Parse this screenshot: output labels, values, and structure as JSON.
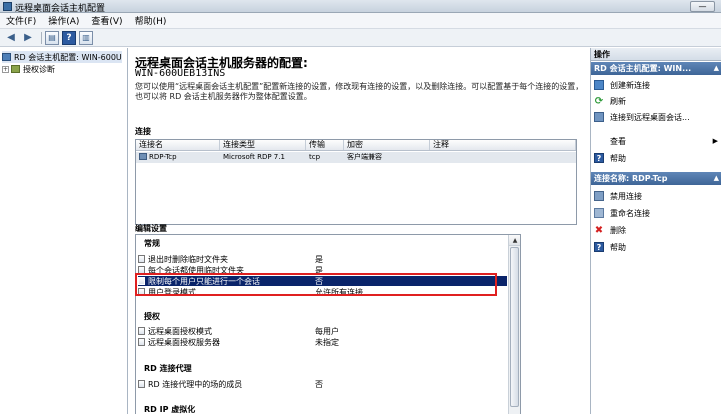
{
  "window": {
    "title": "远程桌面会话主机配置",
    "minimize_symbol": "—"
  },
  "menu": [
    "文件(F)",
    "操作(A)",
    "查看(V)",
    "帮助(H)"
  ],
  "tree": {
    "root_label": "RD 会话主机配置: WIN-600U",
    "child_label": "授权诊断"
  },
  "main": {
    "title": "远程桌面会话主机服务器的配置:",
    "server": "WIN-600UEB13INS",
    "description": "您可以使用“远程桌面会话主机配置”配置新连接的设置，修改现有连接的设置，以及删除连接。可以配置基于每个连接的设置，也可以将 RD 会话主机服务器作为整体配置设置。",
    "connections_label": "连接",
    "connections_columns": [
      "连接名",
      "连接类型",
      "传输",
      "加密",
      "注释"
    ],
    "connections_rows": [
      {
        "name": "RDP-Tcp",
        "type": "Microsoft RDP 7.1",
        "transport": "tcp",
        "encryption": "客户端兼容",
        "comment": ""
      }
    ],
    "edit_settings_label": "编辑设置",
    "groups": [
      {
        "title": "常规",
        "rows": [
          {
            "name": "退出时删除临时文件夹",
            "value": "是"
          },
          {
            "name": "每个会话都使用临时文件夹",
            "value": "是"
          },
          {
            "name": "限制每个用户只能进行一个会话",
            "value": "否"
          },
          {
            "name": "用户登录模式",
            "value": "允许所有连接"
          }
        ]
      },
      {
        "title": "授权",
        "rows": [
          {
            "name": "远程桌面授权模式",
            "value": "每用户"
          },
          {
            "name": "远程桌面授权服务器",
            "value": "未指定"
          }
        ]
      },
      {
        "title": "RD 连接代理",
        "rows": [
          {
            "name": "RD 连接代理中的场的成员",
            "value": "否"
          }
        ]
      },
      {
        "title": "RD IP 虚拟化",
        "rows": []
      }
    ]
  },
  "actions": {
    "header": "操作",
    "section1_title": "RD 会话主机配置: WIN...",
    "section1_items": [
      "创建新连接",
      "刷新",
      "连接到远程桌面会话...",
      "查看",
      "帮助"
    ],
    "section2_title": "连接名称: RDP-Tcp",
    "section2_items": [
      "禁用连接",
      "重命名连接",
      "删除",
      "帮助"
    ]
  },
  "colors": {
    "selection": "#0a246a",
    "highlight_box": "#e02020",
    "action_header": "#3e6597"
  }
}
